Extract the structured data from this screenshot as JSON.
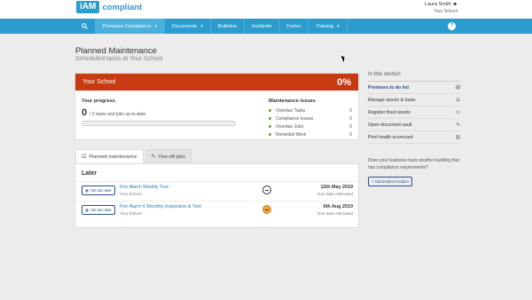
{
  "brand": {
    "logo_box": "iAM",
    "logo_text": "compliant",
    "accent": "#2b9ccf"
  },
  "user": {
    "name": "Laura Smith",
    "school": "Your School"
  },
  "nav": {
    "search_icon": "search-icon",
    "items": [
      {
        "label": "Premises Compliance",
        "caret": "▾"
      },
      {
        "label": "Documents",
        "caret": "▾"
      },
      {
        "label": "Bulletins"
      },
      {
        "label": "Incidents"
      },
      {
        "label": "Forms"
      },
      {
        "label": "Training",
        "caret": "▾"
      }
    ],
    "help": "?"
  },
  "page": {
    "title": "Planned Maintenance",
    "subtitle": "Scheduled tasks at Your School"
  },
  "school_card": {
    "name": "Your School",
    "percent": "0%",
    "header_color": "#c73a12",
    "progress": {
      "title": "Your progress",
      "count": "0",
      "text": "/ 2 tasks and jobs up-to-date.",
      "fraction": 0
    },
    "issues": {
      "title": "Maintenance issues",
      "rows": [
        {
          "label": "Overdue Tasks",
          "count": "0"
        },
        {
          "label": "Compliance Issues",
          "count": "0"
        },
        {
          "label": "Overdue Jobs",
          "count": "0"
        },
        {
          "label": "Remedial Work",
          "count": "0"
        }
      ]
    }
  },
  "tabs": [
    {
      "label": "Planned maintenance",
      "icon": "☑"
    },
    {
      "label": "One-off jobs",
      "icon": "✎"
    }
  ],
  "tasks": {
    "group": "Later",
    "rows": [
      {
        "button": "Set due date",
        "name": "Fire Alarm Weekly Test",
        "school": "Your School",
        "date": "12th May 2019",
        "note": "Due date estimated"
      },
      {
        "button": "Set due date",
        "name": "Fire Alarm 6 Monthly Inspection & Test",
        "school": "Your School",
        "date": "6th Aug 2019",
        "note": "Due date estimated"
      }
    ]
  },
  "sidebar": {
    "heading": "In this section",
    "items": [
      {
        "label": "Premises to do list",
        "icon": "☑"
      },
      {
        "label": "Manage assets & tasks",
        "icon": "☰"
      },
      {
        "label": "Register fixed assets",
        "icon": "▭"
      },
      {
        "label": "Open document vault",
        "icon": "✎"
      },
      {
        "label": "Print health scorecard",
        "icon": "▥"
      }
    ],
    "note": "Does your business have another building that has compliance requirements?",
    "add_button": "+ Add another location"
  }
}
